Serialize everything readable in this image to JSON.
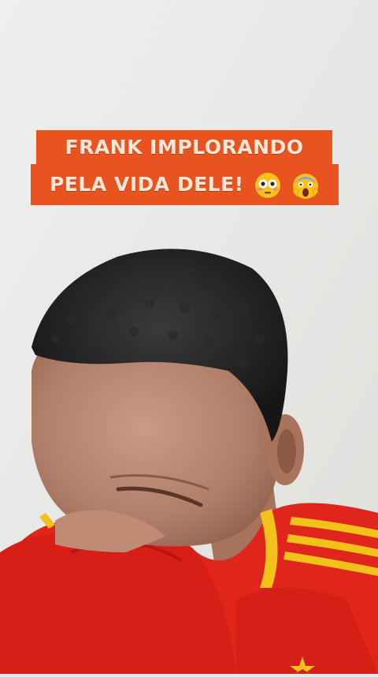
{
  "caption": {
    "line1": "FRANK IMPLORANDO",
    "line2": "PELA VIDA DELE!",
    "emojis": [
      "flushed-face-emoji",
      "screaming-face-emoji"
    ]
  },
  "colors": {
    "caption_background": "#e8531f",
    "caption_text": "#fbe7d8",
    "wall": "#e9e9e7",
    "jersey_red": "#e0261c",
    "jersey_stripe": "#f2c21a"
  }
}
